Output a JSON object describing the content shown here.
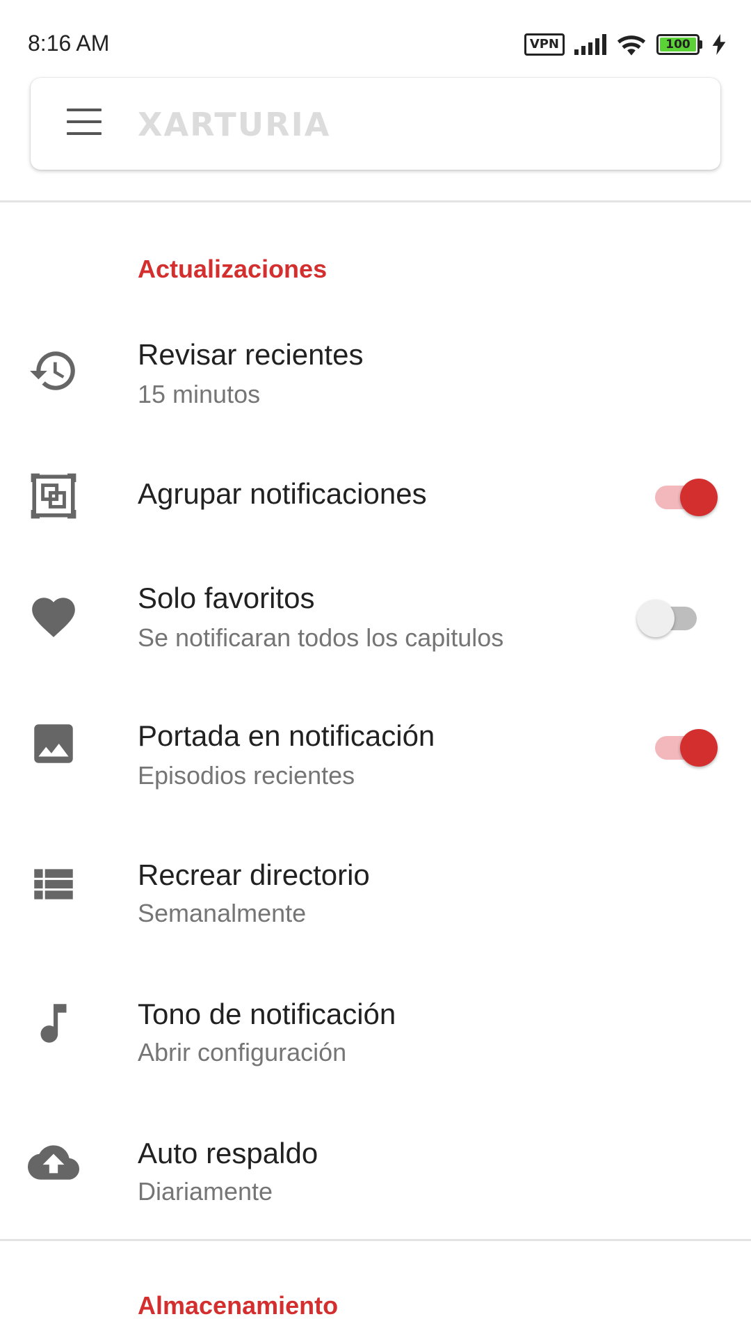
{
  "status_bar": {
    "time": "8:16 AM",
    "vpn_label": "VPN",
    "battery_level": "100",
    "icons": [
      "vpn-icon",
      "signal-icon",
      "wifi-icon",
      "battery-icon",
      "charging-icon"
    ]
  },
  "search": {
    "placeholder": "XARTURIA"
  },
  "sections": {
    "updates": "Actualizaciones",
    "storage": "Almacenamiento"
  },
  "preferences": [
    {
      "icon": "history-icon",
      "title": "Revisar recientes",
      "summary": "15 minutos"
    },
    {
      "icon": "group-notifications-icon",
      "title": "Agrupar notificaciones",
      "summary": "",
      "switch": true,
      "checked": true
    },
    {
      "icon": "heart-icon",
      "title": "Solo favoritos",
      "summary": "Se notificaran todos los capitulos",
      "switch": true,
      "checked": false
    },
    {
      "icon": "image-icon",
      "title": "Portada en notificación",
      "summary": "Episodios recientes",
      "switch": true,
      "checked": true
    },
    {
      "icon": "list-icon",
      "title": "Recrear directorio",
      "summary": "Semanalmente"
    },
    {
      "icon": "music-note-icon",
      "title": "Tono de notificación",
      "summary": "Abrir configuración"
    },
    {
      "icon": "cloud-upload-icon",
      "title": "Auto respaldo",
      "summary": "Diariamente"
    }
  ],
  "colors": {
    "accent": "#d32f2f",
    "accent_track": "#f2b8bb",
    "icon": "#666666",
    "summary": "#757575"
  }
}
